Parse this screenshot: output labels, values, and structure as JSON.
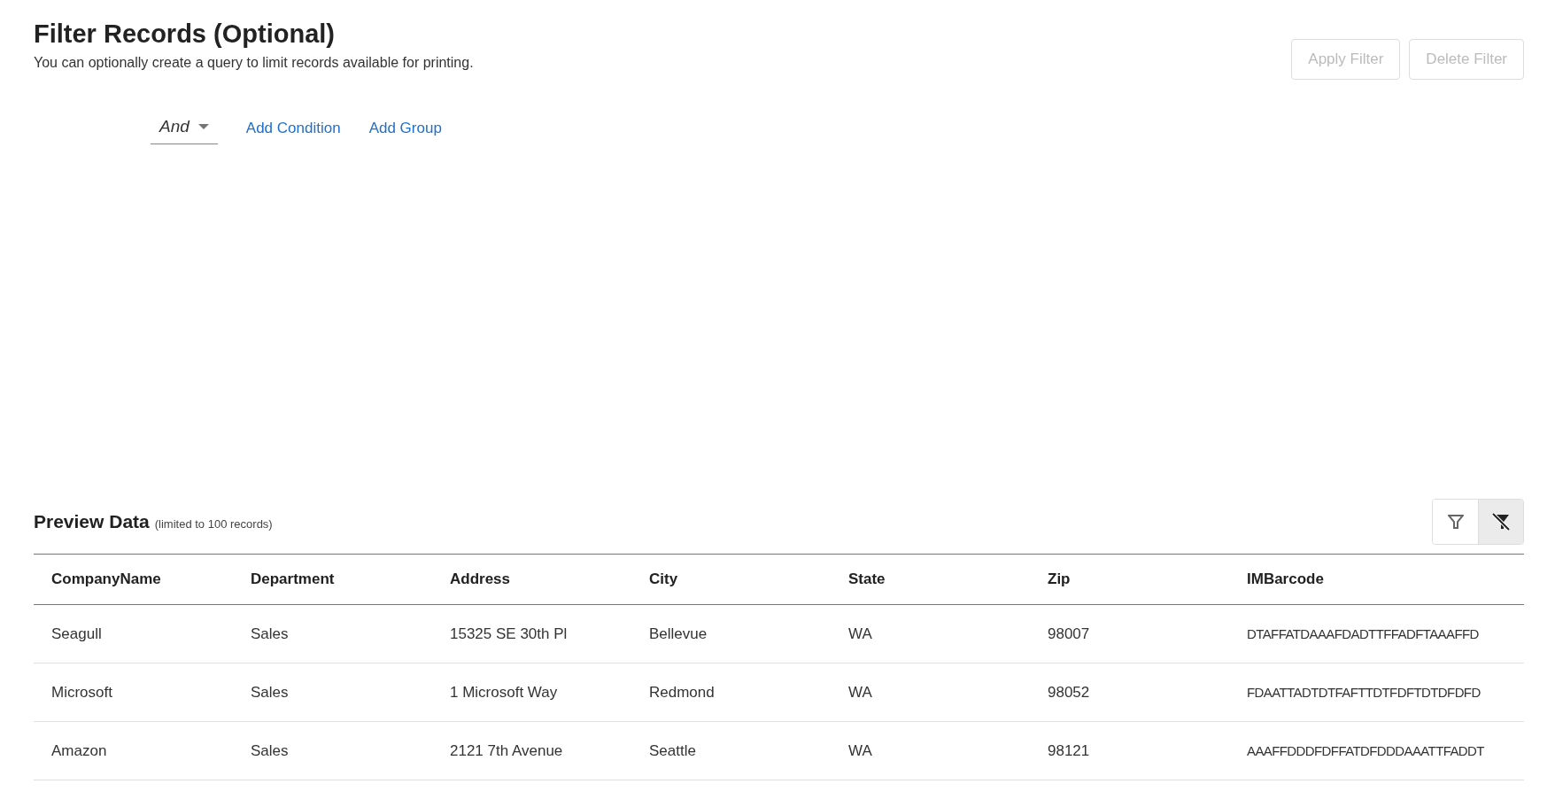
{
  "header": {
    "title": "Filter Records (Optional)",
    "subtitle": "You can optionally create a query to limit records available for printing."
  },
  "actions": [
    {
      "label": "Apply Filter",
      "disabled": true
    },
    {
      "label": "Delete Filter",
      "disabled": true
    }
  ],
  "query": {
    "operator": "And",
    "links": [
      "Add Condition",
      "Add Group"
    ]
  },
  "preview": {
    "title": "Preview Data",
    "note": "(limited to 100 records)",
    "tools": [
      {
        "kind": "filter",
        "selected": false
      },
      {
        "kind": "clear-filter",
        "selected": true
      }
    ],
    "columns": [
      "CompanyName",
      "Department",
      "Address",
      "City",
      "State",
      "Zip",
      "IMBarcode"
    ],
    "rows": [
      [
        "Seagull",
        "Sales",
        "15325 SE 30th Pl",
        "Bellevue",
        "WA",
        "98007",
        "DTAFFATDAAAFDADTTFFADFTAAAFFD"
      ],
      [
        "Microsoft",
        "Sales",
        "1 Microsoft Way",
        "Redmond",
        "WA",
        "98052",
        "FDAATTADTDTFAFTTDTFDFTDTDFDFD"
      ],
      [
        "Amazon",
        "Sales",
        "2121 7th Avenue",
        "Seattle",
        "WA",
        "98121",
        "AAAFFDDDFDFFATDFDDDAAATTFADDT"
      ]
    ]
  }
}
